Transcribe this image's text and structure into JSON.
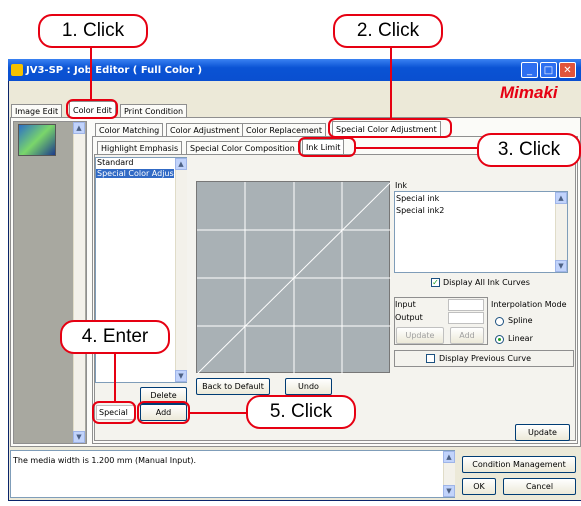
{
  "callouts": {
    "c1": "1. Click",
    "c2": "2. Click",
    "c3": "3. Click",
    "c4": "4. Enter",
    "c5": "5. Click"
  },
  "window": {
    "title": "JV3-SP : Job Editor ( Full Color )",
    "brand": "Mimaki"
  },
  "main_tabs": [
    "Image Edit",
    "Color Edit",
    "Print Condition"
  ],
  "sub_tabs": [
    "Color Matching",
    "Color Adjustment",
    "Color Replacement",
    "Special Color Adjustment"
  ],
  "inner_tabs": [
    "Highlight Emphasis",
    "Special Color Composition",
    "Ink Limit"
  ],
  "list": {
    "items": [
      "Standard",
      "Special Color Adjus"
    ],
    "delete": "Delete",
    "name_value": "Special",
    "add": "Add"
  },
  "buttons": {
    "back_to_default": "Back to Default",
    "undo": "Undo",
    "update": "Update",
    "cond_mgmt": "Condition Management",
    "ok": "OK",
    "cancel": "Cancel"
  },
  "ink": {
    "label": "Ink",
    "items": [
      "Special ink",
      "Special ink2"
    ],
    "display_all": "Display All Ink Curves",
    "display_all_checked": true
  },
  "io": {
    "input": "Input",
    "output": "Output",
    "update": "Update",
    "add": "Add"
  },
  "interp": {
    "label": "Interpolation Mode",
    "spline": "Spline",
    "linear": "Linear",
    "selected": "Linear"
  },
  "display_prev": "Display Previous Curve",
  "status": "The media width is 1.200 mm (Manual Input).",
  "colors": {
    "accent": "#e60012",
    "titlebar": "#0a53d4",
    "selection": "#316ac5"
  }
}
